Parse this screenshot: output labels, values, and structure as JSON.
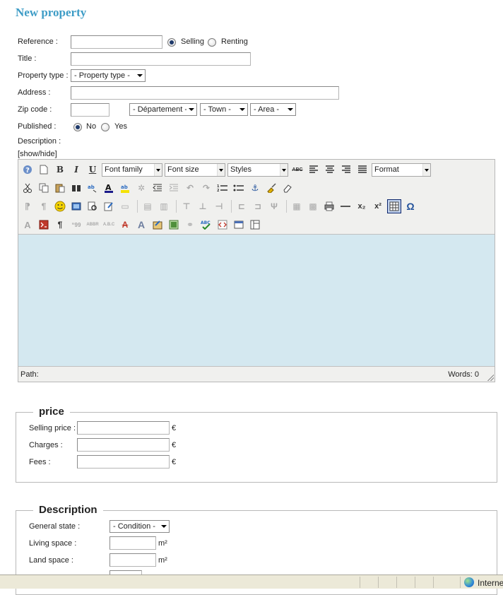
{
  "page": {
    "title": "New property"
  },
  "form": {
    "reference_label": "Reference :",
    "selling_label": "Selling",
    "renting_label": "Renting",
    "title_label": "Title :",
    "property_type_label": "Property type :",
    "property_type_value": "- Property type -",
    "address_label": "Address :",
    "zip_label": "Zip code :",
    "department_value": "- Département -",
    "town_value": "- Town -",
    "area_value": "- Area -",
    "published_label": "Published :",
    "no_label": "No",
    "yes_label": "Yes",
    "description_label": "Description :",
    "showhide_label": "[show/hide]"
  },
  "editor": {
    "font_family": "Font family",
    "font_size": "Font size",
    "styles": "Styles",
    "format": "Format",
    "path_label": "Path:",
    "words_label": "Words: 0",
    "bold_glyph": "B",
    "italic_glyph": "I",
    "underline_glyph": "U",
    "strike_glyph": "ABC",
    "omega_glyph": "Ω",
    "pilcrow_glyph": "¶",
    "sub_glyph": "x₂",
    "sup_glyph": "x²"
  },
  "price": {
    "legend": "price",
    "selling_price_label": "Selling price :",
    "charges_label": "Charges :",
    "fees_label": "Fees :",
    "currency": "€"
  },
  "description": {
    "legend": "Description",
    "general_state_label": "General state :",
    "condition_value": "- Condition -",
    "living_space_label": "Living space :",
    "land_space_label": "Land space :",
    "area_unit": "m²"
  },
  "statusbar": {
    "zone_text": "Interne"
  }
}
